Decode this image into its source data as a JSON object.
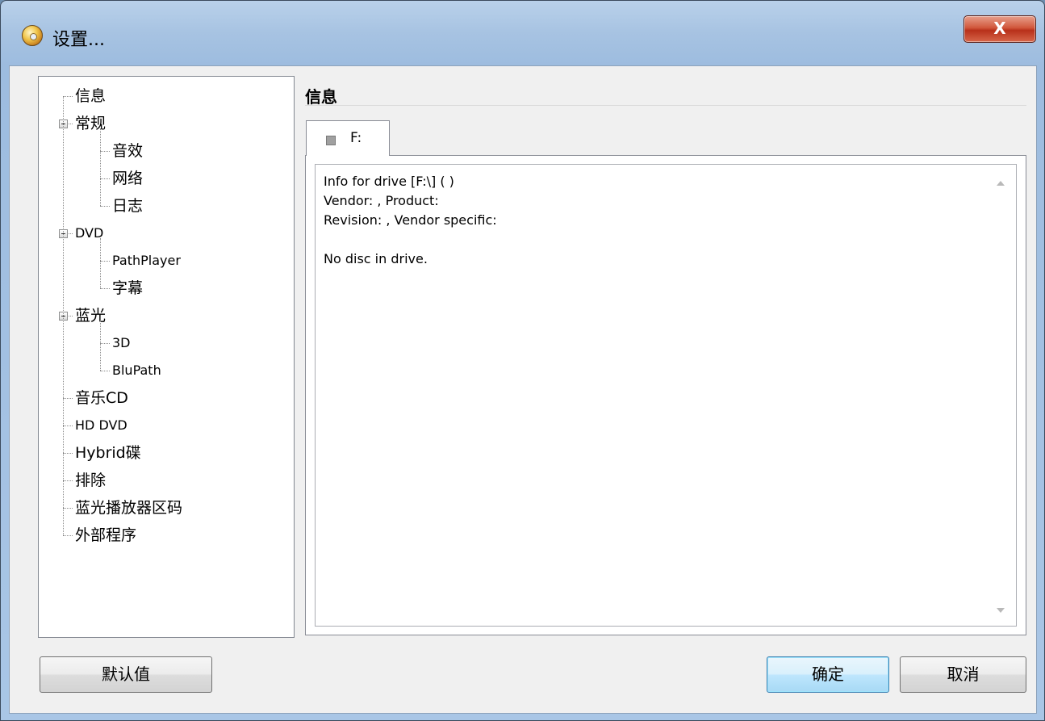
{
  "window": {
    "title": "设置...",
    "close_label": "X",
    "icon": "disc-app-icon"
  },
  "tree": {
    "items": [
      {
        "label": "信息",
        "level": 0,
        "expandable": false
      },
      {
        "label": "常规",
        "level": 0,
        "expandable": true,
        "expanded": true
      },
      {
        "label": "音效",
        "level": 1
      },
      {
        "label": "网络",
        "level": 1
      },
      {
        "label": "日志",
        "level": 1
      },
      {
        "label": "DVD",
        "level": 0,
        "expandable": true,
        "expanded": true
      },
      {
        "label": "PathPlayer",
        "level": 1
      },
      {
        "label": "字幕",
        "level": 1
      },
      {
        "label": "蓝光",
        "level": 0,
        "expandable": true,
        "expanded": true
      },
      {
        "label": "3D",
        "level": 1
      },
      {
        "label": "BluPath",
        "level": 1
      },
      {
        "label": "音乐CD",
        "level": 0
      },
      {
        "label": "HD DVD",
        "level": 0
      },
      {
        "label": "Hybrid碟",
        "level": 0
      },
      {
        "label": "排除",
        "level": 0
      },
      {
        "label": "蓝光播放器区码",
        "level": 0
      },
      {
        "label": "外部程序",
        "level": 0
      }
    ]
  },
  "section": {
    "title": "信息"
  },
  "tabs": [
    {
      "label": "F:",
      "selected": true
    }
  ],
  "info": {
    "lines": [
      "Info for drive [F:\\] ( )",
      "Vendor: , Product:",
      "Revision: , Vendor specific:",
      "",
      "No disc in drive."
    ]
  },
  "buttons": {
    "defaults": "默认值",
    "ok": "确定",
    "cancel": "取消"
  },
  "colors": {
    "window_frame": "#a9c6e6",
    "close_button": "#c8452a",
    "dialog_bg": "#f0f0f0",
    "default_button": "#bee6fd"
  }
}
